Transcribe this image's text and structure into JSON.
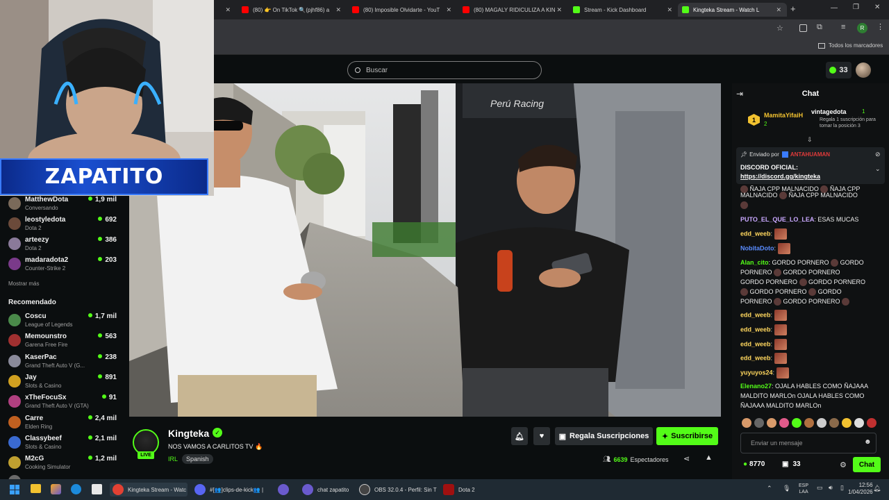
{
  "browser": {
    "tabs": [
      {
        "title": "(80) 👉 On TikTok 🔍(pjhf86) a",
        "color": "#ff0000"
      },
      {
        "title": "(80) Imposible Olvidarte - YouT",
        "color": "#ff0000"
      },
      {
        "title": "(80) MAGALY RIDICULIZA A KIN",
        "color": "#ff0000"
      },
      {
        "title": "Stream - Kick Dashboard",
        "color": "#53fc18"
      },
      {
        "title": "Kingteka Stream - Watch L",
        "color": "#53fc18"
      }
    ],
    "new_tab": "+",
    "bookmarks_label": "Todos los marcadores",
    "profile_initial": "R"
  },
  "header": {
    "search_placeholder": "Buscar",
    "kick_points": "33"
  },
  "webcam": {
    "overlay_name": "ZAPATITO"
  },
  "sidebar": {
    "following": [
      {
        "name": "MatthewDota",
        "game": "Conversando",
        "viewers": "1,9 mil",
        "color": "#7a6a5a"
      },
      {
        "name": "leostyledota",
        "game": "Dota 2",
        "viewers": "692",
        "color": "#6b4a3a"
      },
      {
        "name": "arteezy",
        "game": "Dota 2",
        "viewers": "386",
        "color": "#8a7a9a"
      },
      {
        "name": "madaradota2",
        "game": "Counter-Strike 2",
        "viewers": "203",
        "color": "#7a3a8a"
      }
    ],
    "show_more": "Mostrar más",
    "recommended_title": "Recomendado",
    "recommended": [
      {
        "name": "Coscu",
        "game": "League of Legends",
        "viewers": "1,7 mil",
        "color": "#4a8a4a"
      },
      {
        "name": "Memounstro",
        "game": "Garena Free Fire",
        "viewers": "563",
        "color": "#a03030"
      },
      {
        "name": "KaserPac",
        "game": "Grand Theft Auto V (G...",
        "viewers": "238",
        "color": "#8a8a9a"
      },
      {
        "name": "Jay",
        "game": "Slots & Casino",
        "viewers": "891",
        "color": "#d0a020"
      },
      {
        "name": "xTheFocuSx",
        "game": "Grand Theft Auto V (GTA)",
        "viewers": "91",
        "color": "#b04080"
      },
      {
        "name": "Carre",
        "game": "Elden Ring",
        "viewers": "2,4 mil",
        "color": "#c06020"
      },
      {
        "name": "Classybeef",
        "game": "Slots & Casino",
        "viewers": "2,1 mil",
        "color": "#3a6ad0"
      },
      {
        "name": "M2cG",
        "game": "Cooking Simulator",
        "viewers": "1,2 mil",
        "color": "#c0a030"
      }
    ]
  },
  "stream": {
    "streamer": "Kingteka",
    "live_badge": "LIVE",
    "title": "NOS VAMOS A CARLITOS TV 🔥",
    "category": "IRL",
    "language": "Spanish",
    "gift_label": "Regala Suscripciones",
    "subscribe_label": "Suscribirse",
    "viewers": "6639",
    "viewers_label": "Espectadores"
  },
  "chat": {
    "title": "Chat",
    "leader": {
      "rank": "1",
      "name": "MamitaYifaiH",
      "count": "2"
    },
    "gift_user": {
      "name": "vintagedota",
      "count": "1",
      "note": "Regala 1 suscripción para tomar la posición 3"
    },
    "pinned": {
      "sent_by_label": "Enviado por",
      "sent_by": "ANTAHUAMAN",
      "line1": "DISCORD OFICIAL:",
      "line2": "https://discord.gg/kingteka"
    },
    "partial_line1": "ÑAJA CPP MALNACIDO",
    "partial_line1b": "ÑAJA CPP",
    "partial_line2": "MALNACIDO",
    "partial_line2b": "ÑAJA CPP MALNACIDO",
    "messages": [
      {
        "user": "PUTO_EL_QUE_LO_LEA",
        "color": "#c9a8ff",
        "text": ": ESAS MUCAS"
      },
      {
        "user": "edd_weeb",
        "color": "#ffd75e",
        "text": ":"
      },
      {
        "user": "NobitaDoto",
        "color": "#5a8cff",
        "text": ":"
      },
      {
        "user": "Alan_cito",
        "color": "#53fc18",
        "text": ": GORDO PORNERO"
      },
      {
        "user": "edd_weeb",
        "color": "#ffd75e",
        "text": ":"
      },
      {
        "user": "edd_weeb",
        "color": "#ffd75e",
        "text": ":"
      },
      {
        "user": "edd_weeb",
        "color": "#ffd75e",
        "text": ":"
      },
      {
        "user": "edd_weeb",
        "color": "#ffd75e",
        "text": ":"
      },
      {
        "user": "yuyuyos24",
        "color": "#ffd75e",
        "text": ":"
      },
      {
        "user": "Elenano27",
        "color": "#53fc18",
        "text": ": OJALA HABLES COMO ÑAJAAA MALDITO MARLOn OJALA HABLES COMO ÑAJAAA MALDITO MARLOn"
      }
    ],
    "gordo_lines": [
      "PORNERO",
      "GORDO PORNERO",
      "GORDO PORNERO",
      "GORDO PORNERO",
      "GORDO",
      "PORNERO",
      "GORDO PORNERO",
      "GORDO"
    ],
    "input_placeholder": "Enviar un mensaje",
    "points": "8770",
    "gifts": "33",
    "send_label": "Chat"
  },
  "taskbar": {
    "apps": [
      {
        "label": "Kingteka Stream - Watc",
        "color": "#e34133"
      },
      {
        "label": "#[👥]clips-de-kick👥 |",
        "color": "#5865f2"
      },
      {
        "label": "",
        "color": "#6a5acd"
      },
      {
        "label": "chat zapatito",
        "color": "#6a5acd"
      },
      {
        "label": "OBS 32.0.4 - Perfil: Sin T",
        "color": "#444"
      },
      {
        "label": "Dota 2",
        "color": "#a01010"
      }
    ],
    "lang": "ESP",
    "lang2": "LAA",
    "time": "12:56",
    "date": "1/04/2026"
  }
}
